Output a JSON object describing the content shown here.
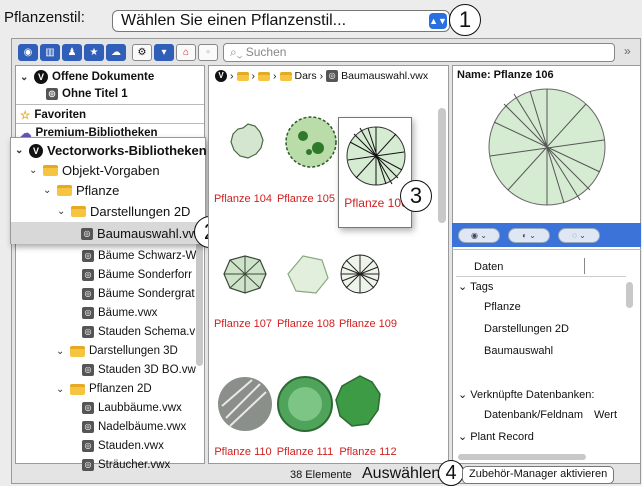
{
  "top": {
    "label": "Pflanzenstil:",
    "select_value": "Wählen Sie einen Pflanzenstil..."
  },
  "search": {
    "placeholder": "Suchen"
  },
  "tree": {
    "open_documents": "Offene Dokumente",
    "untitled": "Ohne Titel 1",
    "favorites": "Favoriten",
    "premium": "Premium-Bibliotheken",
    "vw_libraries": "Vectorworks-Bibliotheken",
    "object_defaults": "Objekt-Vorgaben",
    "plants": "Pflanze",
    "representations_2d": "Darstellungen 2D",
    "tree_selection": "Baumauswahl.vwx",
    "files": [
      "Bäume Schwarz-W",
      "Bäume Sonderforr",
      "Bäume Sondergrat",
      "Bäume.vwx",
      "Stauden Schema.v"
    ],
    "representations_3d": "Darstellungen 3D",
    "stauden_3d": "Stauden 3D BO.vw",
    "plants_2d": "Pflanzen 2D",
    "files_2d": [
      "Laubbäume.vwx",
      "Nadelbäume.vwx",
      "Stauden.vwx",
      "Sträucher.vwx"
    ]
  },
  "breadcrumb": {
    "dars": "Dars",
    "file": "Baumauswahl.vwx"
  },
  "grid": {
    "cells": [
      "Pflanze 104",
      "Pflanze 105",
      "Pflanze 106",
      "Pflanze 107",
      "Pflanze 108",
      "Pflanze 109",
      "Pflanze 110",
      "Pflanze 111",
      "Pflanze 112"
    ],
    "selected_name": "Pflanze 106"
  },
  "info": {
    "name_label": "Name: Pflanze 106",
    "data_header": "Daten",
    "tags_label": "Tags",
    "tags": [
      "Pflanze",
      "Darstellungen 2D",
      "Baumauswahl"
    ],
    "linked_db": "Verknüpfte Datenbanken:",
    "db_field": "Datenbank/Feldnam",
    "db_value": "Wert",
    "plant_record": "Plant Record"
  },
  "status": {
    "count": "38 Elemente",
    "choose": "Auswählen",
    "accessory": "Zubehör-Manager aktivieren"
  },
  "callouts": [
    "1",
    "2",
    "3",
    "4"
  ],
  "colors": {
    "accent": "#3b73d8",
    "label_red": "#d02020",
    "folder": "#f5c542"
  }
}
